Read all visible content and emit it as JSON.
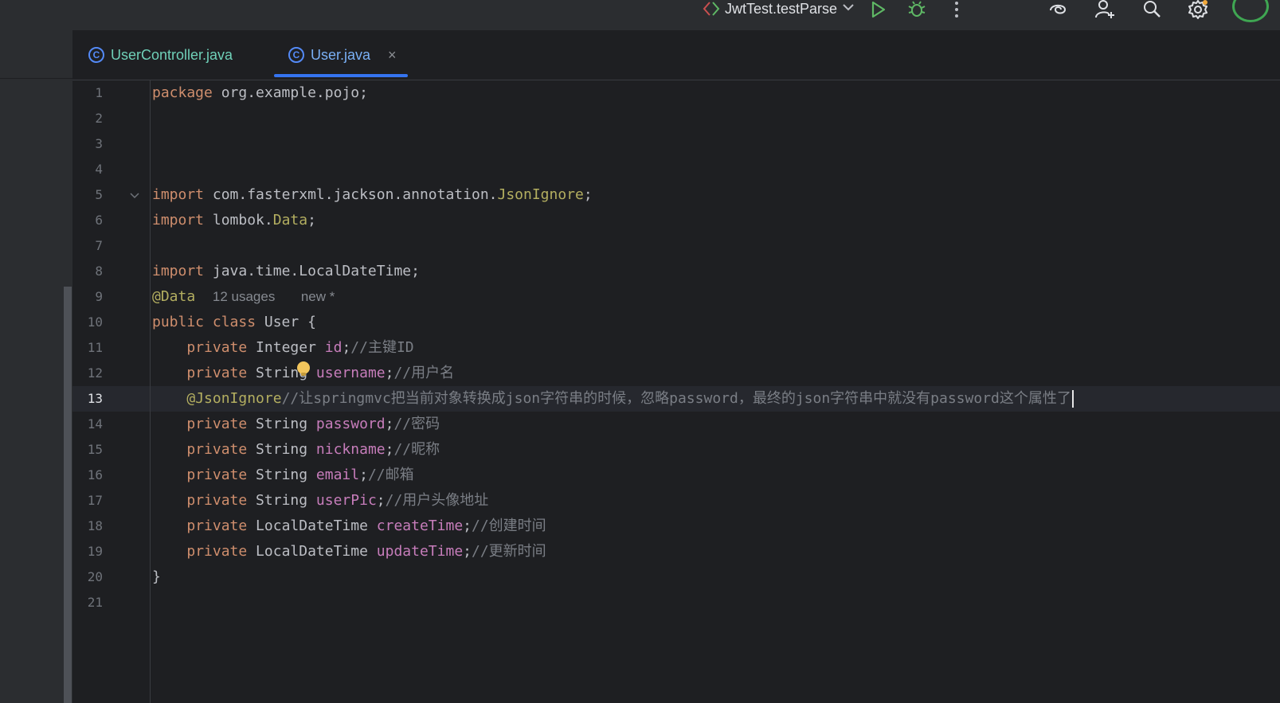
{
  "toolbar": {
    "run_config": "JwtTest.testParse",
    "icons": [
      "vcs-arrows-icon",
      "chevron-down-icon",
      "run-icon",
      "debug-icon",
      "more-icon",
      "ai-assistant-icon",
      "add-user-icon",
      "search-icon",
      "settings-icon"
    ]
  },
  "tabs": [
    {
      "label": "UserController.java",
      "icon": "java-class-icon",
      "active": false
    },
    {
      "label": "User.java",
      "icon": "java-class-icon",
      "active": true,
      "close": "×"
    }
  ],
  "editor": {
    "current_line": 13,
    "line_numbers": [
      "1",
      "2",
      "3",
      "4",
      "5",
      "6",
      "7",
      "8",
      "9",
      "10",
      "11",
      "12",
      "13",
      "14",
      "15",
      "16",
      "17",
      "18",
      "19",
      "20",
      "21"
    ],
    "inlay_hints": {
      "usages": "12 usages",
      "author": "new *"
    },
    "lines": [
      {
        "kw": "package",
        "rest": " org.example.pojo;"
      },
      {},
      {},
      {},
      {
        "kw": "import",
        "rest": " com.fasterxml.jackson.annotation.",
        "ann": "JsonIgnore",
        "tail": ";"
      },
      {
        "kw": "import",
        "rest": " lombok.",
        "ann": "Data",
        "tail": ";"
      },
      {},
      {
        "kw": "import",
        "rest": " java.time.LocalDateTime;"
      },
      {
        "ann": "@Data"
      },
      {
        "kw": "public class",
        "rest": " User {"
      },
      {
        "indent": "    ",
        "kw": "private",
        "type": " Integer ",
        "field": "id",
        "tail": ";",
        "comment": "//主键ID"
      },
      {
        "indent": "    ",
        "kw": "private",
        "type": " String ",
        "field": "username",
        "tail": ";",
        "comment": "//用户名"
      },
      {
        "indent": "    ",
        "ann": "@JsonIgnore",
        "comment": "//让springmvc把当前对象转换成json字符串的时候，忽略password，最终的json字符串中就没有password这个属性了"
      },
      {
        "indent": "    ",
        "kw": "private",
        "type": " String ",
        "field": "password",
        "tail": ";",
        "comment": "//密码"
      },
      {
        "indent": "    ",
        "kw": "private",
        "type": " String ",
        "field": "nickname",
        "tail": ";",
        "comment": "//昵称"
      },
      {
        "indent": "    ",
        "kw": "private",
        "type": " String ",
        "field": "email",
        "tail": ";",
        "comment": "//邮箱"
      },
      {
        "indent": "    ",
        "kw": "private",
        "type": " String ",
        "field": "userPic",
        "tail": ";",
        "comment": "//用户头像地址"
      },
      {
        "indent": "    ",
        "kw": "private",
        "type": " LocalDateTime ",
        "field": "createTime",
        "tail": ";",
        "comment": "//创建时间"
      },
      {
        "indent": "    ",
        "kw": "private",
        "type": " LocalDateTime ",
        "field": "updateTime",
        "tail": ";",
        "comment": "//更新时间"
      },
      {
        "rest": "}"
      },
      {}
    ]
  },
  "colors": {
    "background": "#1e1f22",
    "panel": "#2b2d30",
    "keyword": "#cf8e6d",
    "annotation": "#b3ae60",
    "field": "#c77dbb",
    "comment": "#7a7e85",
    "accent": "#3574f0"
  }
}
